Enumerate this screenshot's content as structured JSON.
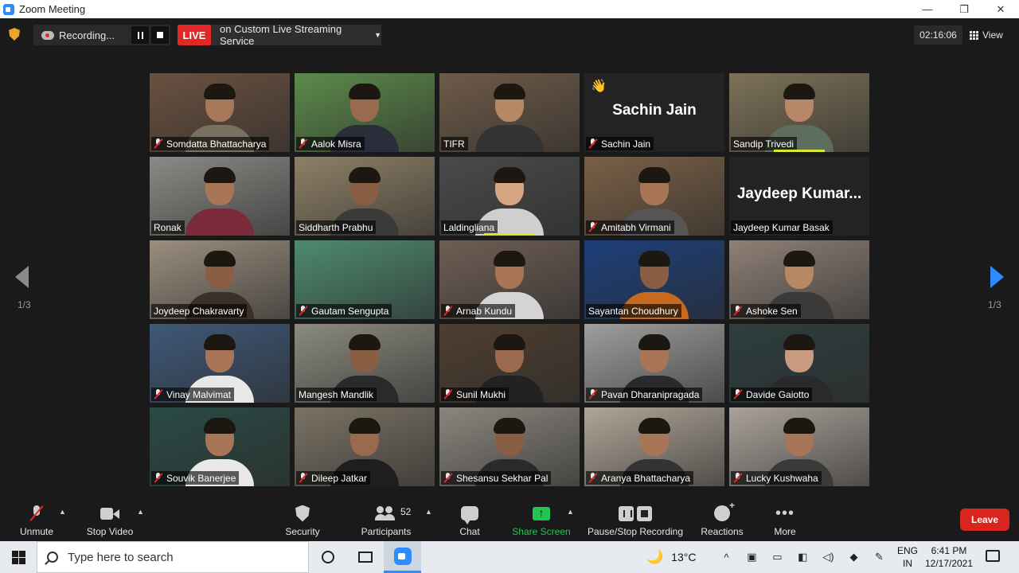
{
  "window": {
    "title": "Zoom Meeting",
    "controls": [
      "—",
      "❐",
      "✕"
    ]
  },
  "topbar": {
    "recording_label": "Recording...",
    "live_label": "LIVE",
    "live_service": "on Custom Live Streaming Service",
    "timer": "02:16:06",
    "view_label": "View"
  },
  "pagination": {
    "prev": "1/3",
    "next": "1/3"
  },
  "tiles": [
    {
      "name": "Somdatta Bhattacharya",
      "muted": true,
      "bg": "#6a5140",
      "shirt": "#7b7060",
      "skin": "#a8785a"
    },
    {
      "name": "Aalok Misra",
      "muted": true,
      "bg": "#5c8a4a",
      "shirt": "#2a2e3a",
      "skin": "#9a6a4e"
    },
    {
      "name": "TIFR",
      "muted": false,
      "bg": "#6e5a48",
      "shirt": "#333",
      "skin": "#b58866"
    },
    {
      "name": "Sachin Jain",
      "muted": true,
      "display": "Sachin Jain",
      "hand": true
    },
    {
      "name": "Sandip Trivedi",
      "muted": false,
      "bg": "#7d7258",
      "shirt": "#5e6e5e",
      "skin": "#b8876a",
      "speaking": true
    },
    {
      "name": "Ronak",
      "muted": false,
      "bg": "#8a8a86",
      "shirt": "#7a2a38",
      "skin": "#a87656"
    },
    {
      "name": "Siddharth Prabhu",
      "muted": false,
      "bg": "#8e8066",
      "shirt": "#3a3a3a",
      "skin": "#8a5e44"
    },
    {
      "name": "Laldingliana",
      "muted": false,
      "bg": "#4a4a4a",
      "shirt": "#cfcfcf",
      "skin": "#d6a684",
      "speaking": true
    },
    {
      "name": "Amitabh Virmani",
      "muted": true,
      "bg": "#7a6046",
      "shirt": "#555",
      "skin": "#a87656"
    },
    {
      "name": "Jaydeep Kumar Basak",
      "muted": false,
      "display": "Jaydeep  Kumar..."
    },
    {
      "name": "Joydeep Chakravarty",
      "muted": false,
      "bg": "#9a8e7e",
      "shirt": "#3a3028",
      "skin": "#8a5e44",
      "active": true
    },
    {
      "name": "Gautam Sengupta",
      "muted": true,
      "bg": "#4e8a70",
      "shirt": "#3a3a3a",
      "skin": "#a87656",
      "empty": true
    },
    {
      "name": "Arnab Kundu",
      "muted": true,
      "bg": "#6e5e54",
      "shirt": "#d4d4d4",
      "skin": "#a87656"
    },
    {
      "name": "Sayantan Choudhury",
      "muted": false,
      "bg": "#1d3f7a",
      "shirt": "#c86a1e",
      "skin": "#8a5e44"
    },
    {
      "name": "Ashoke Sen",
      "muted": true,
      "bg": "#8e8076",
      "shirt": "#3a3a3a",
      "skin": "#b58866"
    },
    {
      "name": "Vinay Malvimat",
      "muted": true,
      "bg": "#3e5878",
      "shirt": "#e8e8e8",
      "skin": "#a87656"
    },
    {
      "name": "Mangesh Mandlik",
      "muted": false,
      "bg": "#8a8a7e",
      "shirt": "#2a2a2a",
      "skin": "#8a5e44"
    },
    {
      "name": "Sunil Mukhi",
      "muted": true,
      "bg": "#4e3e30",
      "shirt": "#222",
      "skin": "#9a6a4e"
    },
    {
      "name": "Pavan Dharanipragada",
      "muted": true,
      "bg": "#9e9e9e",
      "shirt": "#2a2a2a",
      "skin": "#a87656"
    },
    {
      "name": "Davide Gaiotto",
      "muted": true,
      "bg": "#2e3e3e",
      "shirt": "#2a2a2a",
      "skin": "#c89a80"
    },
    {
      "name": "Souvik Banerjee",
      "muted": true,
      "bg": "#2a4a44",
      "shirt": "#e8e8e8",
      "skin": "#a87656"
    },
    {
      "name": "Dileep Jatkar",
      "muted": true,
      "bg": "#7a7264",
      "shirt": "#1e1e1e",
      "skin": "#9a6a4e"
    },
    {
      "name": "Shesansu Sekhar Pal",
      "muted": true,
      "bg": "#8a867e",
      "shirt": "#2a2a2a",
      "skin": "#8a5e44"
    },
    {
      "name": "Aranya Bhattacharya",
      "muted": true,
      "bg": "#b0a698",
      "shirt": "#333",
      "skin": "#a87656"
    },
    {
      "name": "Lucky Kushwaha",
      "muted": true,
      "bg": "#aaa29a",
      "shirt": "#3a3a3a",
      "skin": "#a87656"
    }
  ],
  "toolbar": {
    "unmute": "Unmute",
    "stop_video": "Stop Video",
    "security": "Security",
    "participants": "Participants",
    "participant_count": "52",
    "chat": "Chat",
    "share_screen": "Share Screen",
    "pause_stop_recording": "Pause/Stop Recording",
    "reactions": "Reactions",
    "more": "More",
    "leave": "Leave"
  },
  "taskbar": {
    "search_placeholder": "Type here to search",
    "temperature": "13°C",
    "lang_line1": "ENG",
    "lang_line2": "IN",
    "time": "6:41 PM",
    "date": "12/17/2021"
  },
  "colors": {
    "accent": "#2d8cff",
    "live": "#e02828",
    "share": "#23c552",
    "speaker_highlight": "#d8e830",
    "leave": "#d8261f"
  }
}
